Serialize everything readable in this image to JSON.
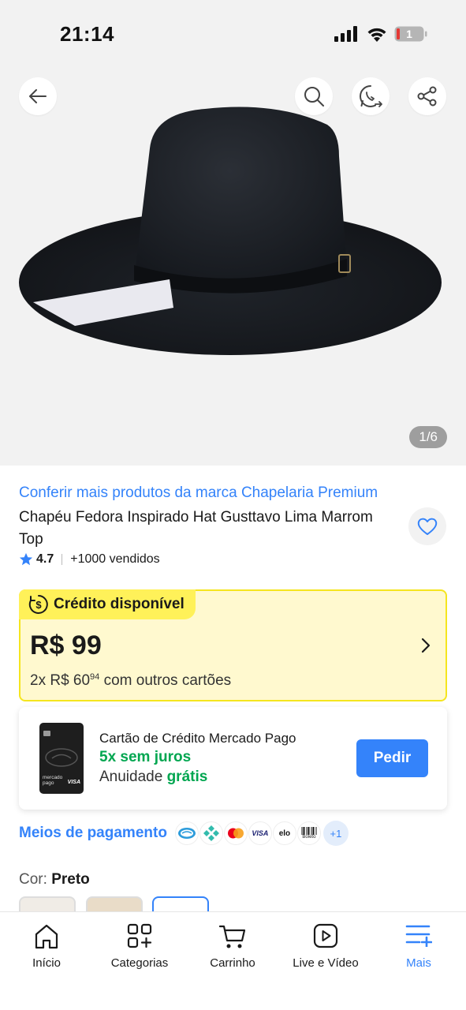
{
  "status_bar": {
    "time": "21:14",
    "battery": "1"
  },
  "gallery": {
    "counter": "1/6"
  },
  "product": {
    "brand_link": "Conferir mais produtos da marca Chapelaria Premium",
    "title": "Chapéu Fedora Inspirado Hat Gusttavo Lima Marrom Top",
    "rating": "4.7",
    "sold": "+1000 vendidos"
  },
  "credit": {
    "tag": "Crédito disponível",
    "amount": "R$ 99",
    "installments_prefix": "2x R$ 60",
    "installments_cents": "94",
    "installments_suffix": " com outros cartões"
  },
  "card_offer": {
    "title": "Cartão de Crédito Mercado Pago",
    "promo": "5x sem juros",
    "fee_label": "Anuidade ",
    "fee_value": "grátis",
    "button": "Pedir",
    "card_brand": "mercado pago",
    "card_network": "VISA"
  },
  "payments": {
    "label": "Meios de pagamento",
    "methods": [
      "mercado-pago-icon",
      "pix-icon",
      "mastercard-icon",
      "VISA",
      "elo",
      "Boleto"
    ],
    "more": "+1"
  },
  "variant": {
    "label": "Cor: ",
    "value": "Preto"
  },
  "nav": {
    "items": [
      {
        "label": "Início",
        "icon": "home-icon"
      },
      {
        "label": "Categorias",
        "icon": "categories-icon"
      },
      {
        "label": "Carrinho",
        "icon": "cart-icon"
      },
      {
        "label": "Live e Vídeo",
        "icon": "video-icon"
      },
      {
        "label": "Mais",
        "icon": "menu-plus-icon"
      }
    ]
  },
  "colors": {
    "accent": "#3483fa",
    "green": "#00a650",
    "credit_bg": "#fff9cf",
    "credit_border": "#f5e51e",
    "credit_tag": "#fff159"
  }
}
